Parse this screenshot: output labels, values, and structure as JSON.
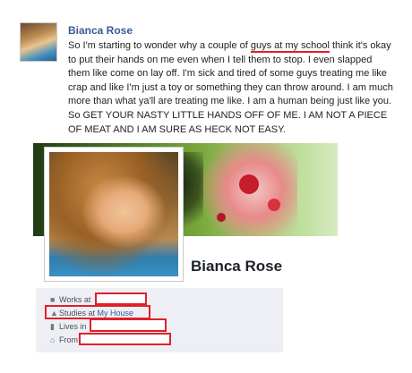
{
  "post": {
    "author": "Bianca Rose",
    "text_before": "So I'm starting to wonder why a couple of ",
    "text_highlight": "guys at my school",
    "text_after": " think it's okay to put their hands on me even when I tell them to stop. I even slapped them like come on lay off. I'm sick and tired of some guys treating me like crap and like I'm just a toy or something they can throw around. I am much more than what ya'll are treating me like. I am a human being just like you. So GET YOUR NASTY LITTLE HANDS OFF OF ME. I AM NOT A PIECE OF MEAT AND I AM SURE AS HECK NOT EASY.",
    "highlight_color": "#e0202a"
  },
  "profile": {
    "name": "Bianca Rose",
    "info": [
      {
        "icon": "briefcase-icon",
        "glyph": "■",
        "label": "Works at ",
        "value": ""
      },
      {
        "icon": "graduation-cap-icon",
        "glyph": "▲",
        "label": "Studies at ",
        "value": "My House"
      },
      {
        "icon": "building-icon",
        "glyph": "▮",
        "label": "Lives in ",
        "value": ""
      },
      {
        "icon": "home-icon",
        "glyph": "⌂",
        "label": "From ",
        "value": ""
      }
    ]
  }
}
